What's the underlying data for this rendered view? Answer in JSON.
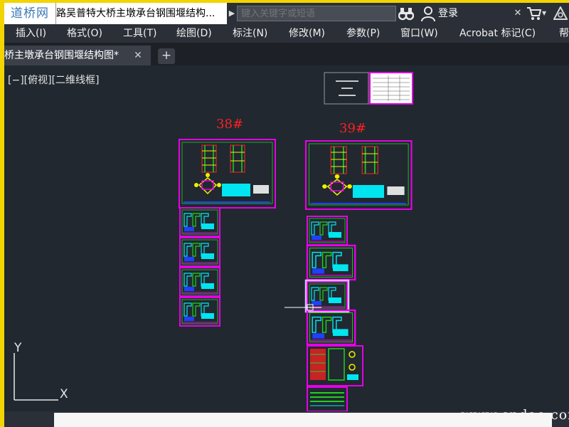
{
  "titlebar": {
    "logo": "道桥网",
    "document_title": "路吴普特大桥主墩承台钢围堰结构...",
    "search_placeholder": "键入关键字或短语",
    "login_label": "登录"
  },
  "menu": [
    "插入(I)",
    "格式(O)",
    "工具(T)",
    "绘图(D)",
    "标注(N)",
    "修改(M)",
    "参数(P)",
    "窗口(W)",
    "Acrobat 标记(C)",
    "帮"
  ],
  "tab": {
    "label": "桥主墩承台钢围堰结构图*",
    "close": "✕",
    "add": "+"
  },
  "viewport": {
    "view_label": "[−][俯视][二维线框]",
    "pier_labels": [
      "38#",
      "39#"
    ],
    "ucs_y": "Y",
    "ucs_x": "X"
  },
  "watermark": "www.cndao.com",
  "colors": {
    "title_bg": "#2b2f37",
    "canvas_bg": "#212830",
    "frame_magenta": "#e600e6",
    "cyan": "#00e5f0",
    "green": "#20d020",
    "red": "#ff2020",
    "yellow": "#f0f000"
  }
}
